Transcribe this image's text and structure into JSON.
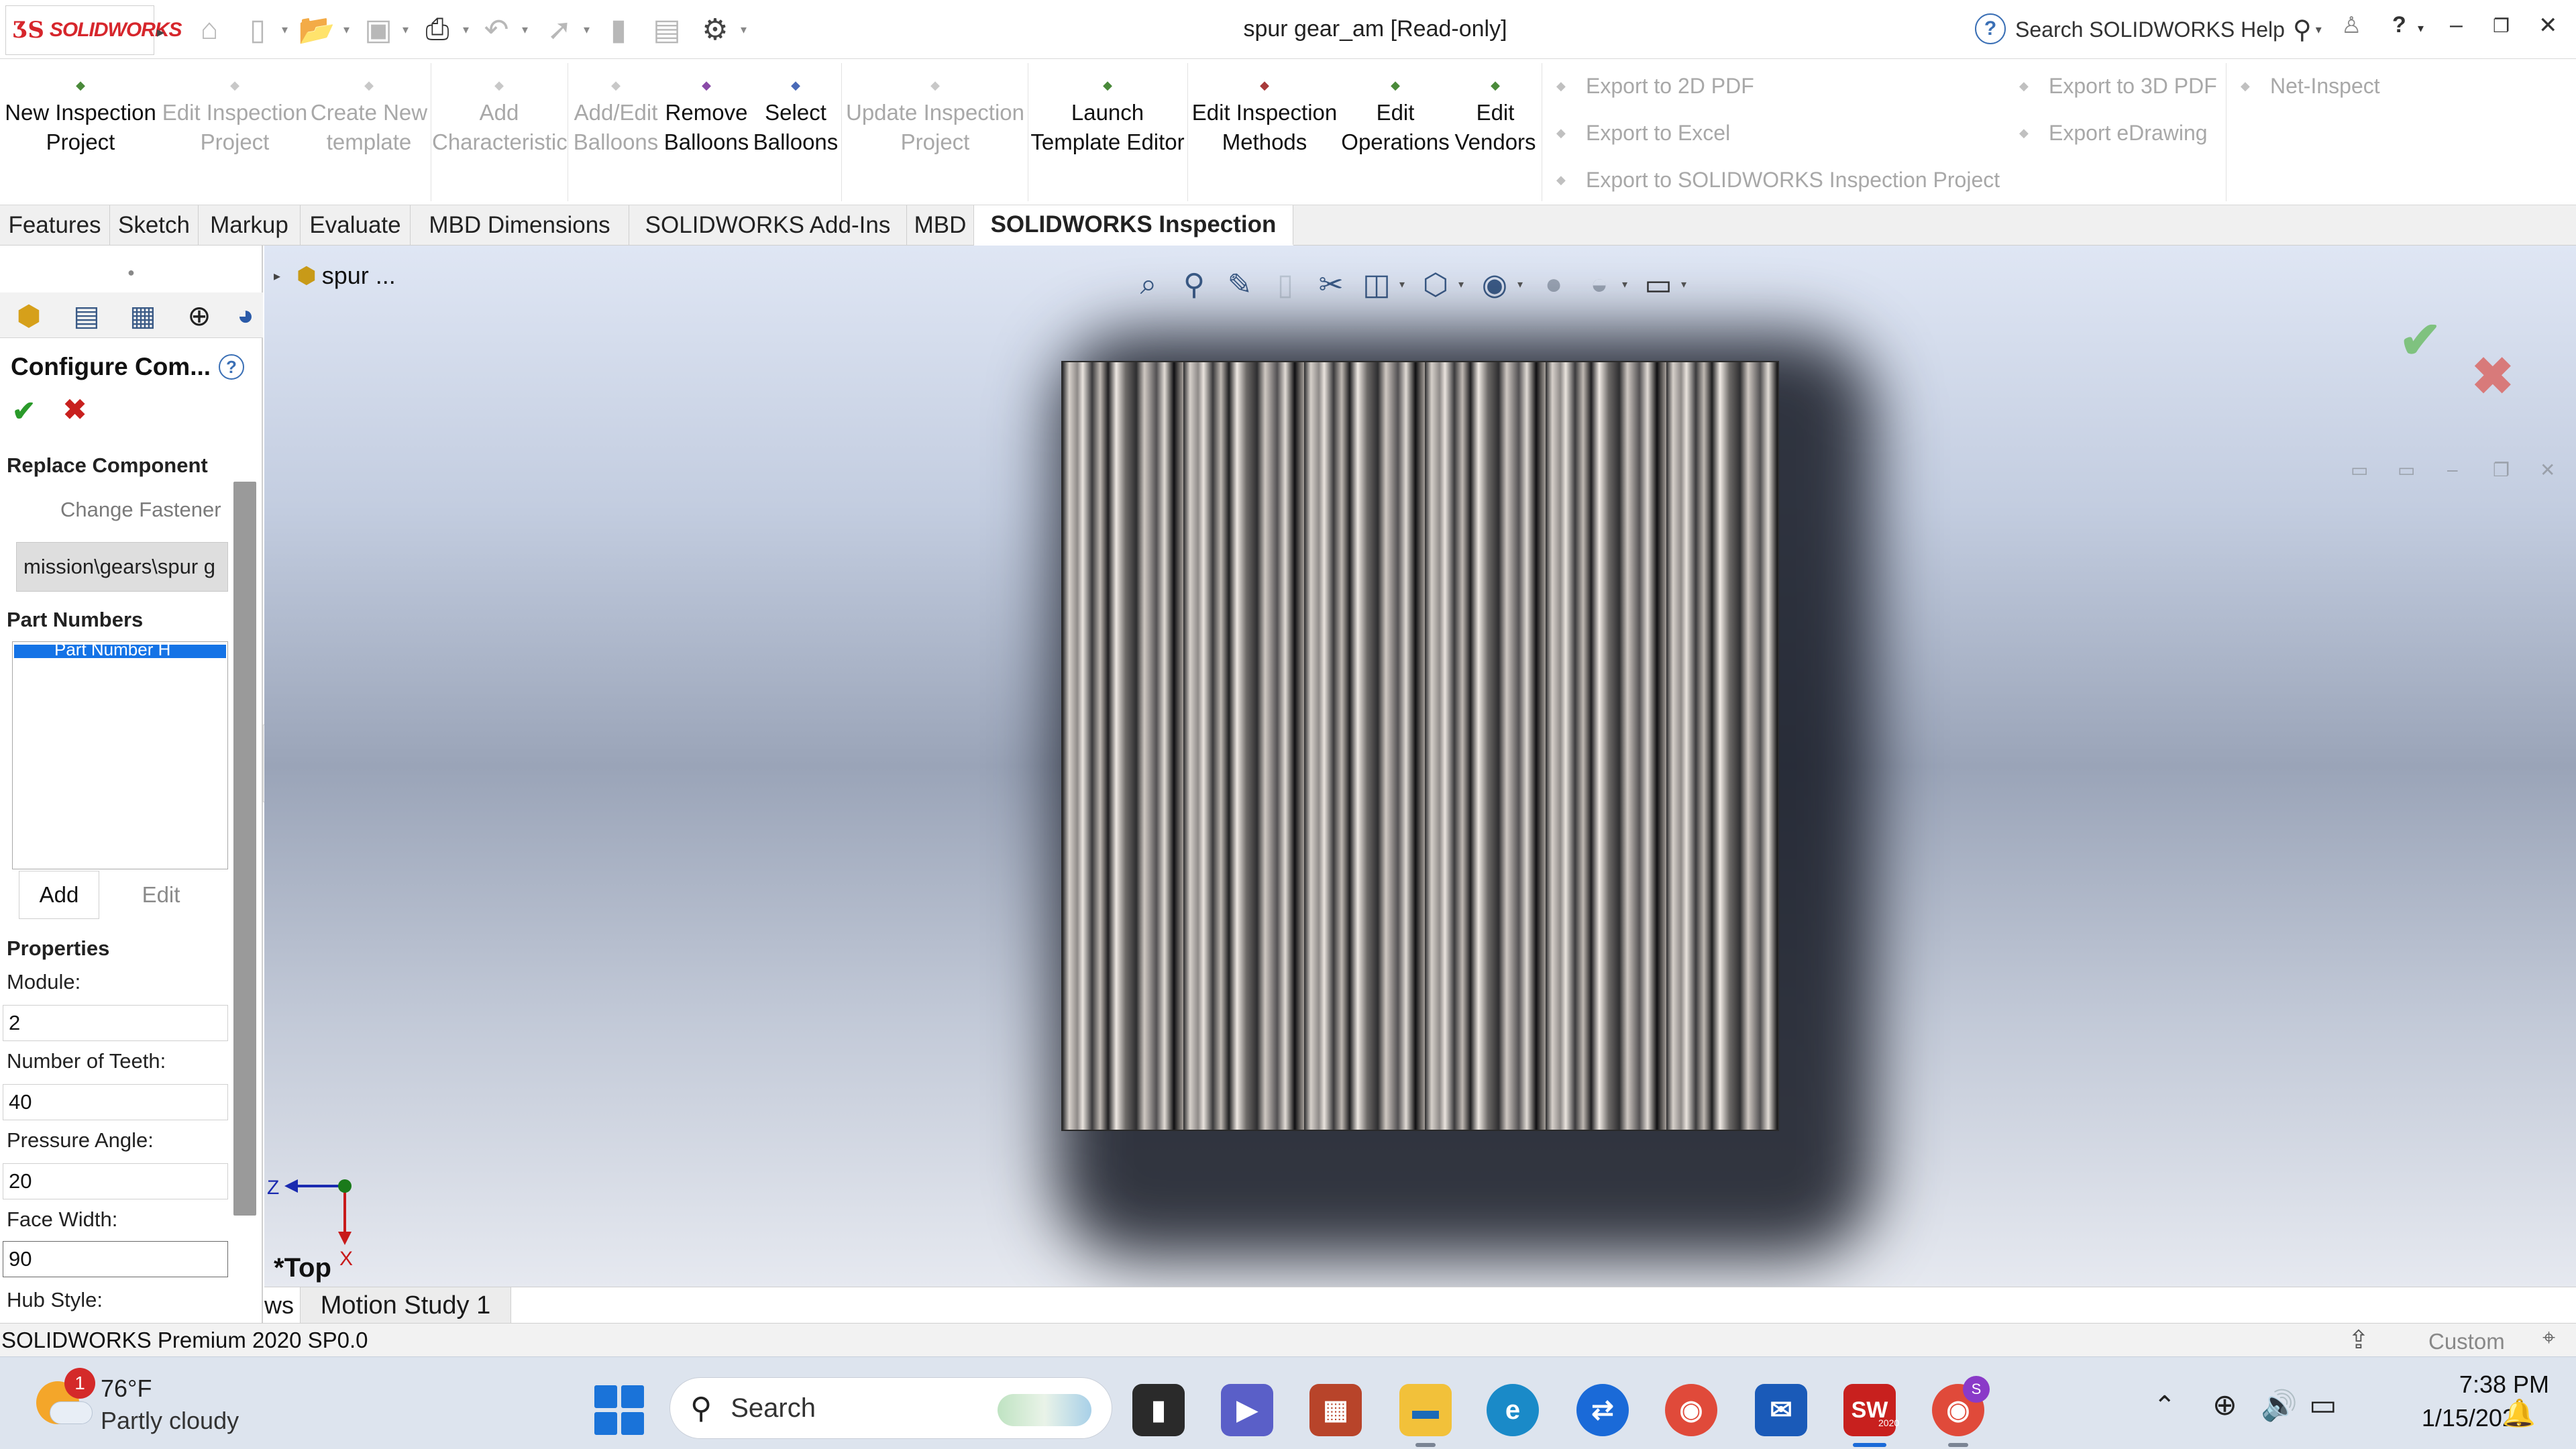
{
  "app": {
    "brand": "SOLIDWORKS",
    "brand_color": "#d6262c",
    "document_title": "spur gear_am [Read-only]",
    "help_search_placeholder": "Search SOLIDWORKS Help"
  },
  "quick_access": {
    "icons": [
      "home-icon",
      "new-document-icon",
      "open-icon",
      "save-icon",
      "print-icon",
      "undo-icon",
      "select-pointer-icon",
      "rebuild-icon",
      "file-properties-icon",
      "options-gear-icon"
    ]
  },
  "ribbon": {
    "new_inspection_project": "New Inspection Project",
    "edit_inspection_project": "Edit Inspection Project",
    "create_new_template": "Create New template",
    "add_characteristic": "Add Characteristic",
    "add_edit_balloons": "Add/Edit Balloons",
    "remove_balloons": "Remove Balloons",
    "select_balloons": "Select Balloons",
    "update_inspection_project": "Update Inspection Project",
    "launch_template_editor": "Launch Template Editor",
    "edit_inspection_methods": "Edit Inspection Methods",
    "edit_operations": "Edit Operations",
    "edit_vendors": "Edit Vendors",
    "export_2d_pdf": "Export to 2D PDF",
    "export_excel": "Export to Excel",
    "export_sw_inspection": "Export to SOLIDWORKS Inspection Project",
    "export_3d_pdf": "Export to 3D PDF",
    "export_edrawing": "Export eDrawing",
    "net_inspect": "Net-Inspect"
  },
  "tabs": [
    "Features",
    "Sketch",
    "Markup",
    "Evaluate",
    "MBD Dimensions",
    "SOLIDWORKS Add-Ins",
    "MBD",
    "SOLIDWORKS Inspection"
  ],
  "active_tab": "SOLIDWORKS Inspection",
  "property_manager": {
    "title": "Configure Com...",
    "replace_component_heading": "Replace Component",
    "change_fastener": "Change Fastener",
    "file_path": "mission\\gears\\spur g",
    "part_numbers_heading": "Part Numbers",
    "selected_part_number": "Part Number H",
    "add_label": "Add",
    "edit_label": "Edit",
    "properties_heading": "Properties",
    "module_label": "Module:",
    "module_value": "2",
    "teeth_label": "Number of Teeth:",
    "teeth_value": "40",
    "pressure_angle_label": "Pressure Angle:",
    "pressure_angle_value": "20",
    "face_width_label": "Face Width:",
    "face_width_value": "90",
    "hub_style_label": "Hub Style:"
  },
  "viewport": {
    "tree_node": "spur ...",
    "view_name": "*Top",
    "triad_z": "Z",
    "triad_x": "X"
  },
  "bottom_tabs": {
    "views_partial": "ws",
    "motion_study": "Motion Study 1"
  },
  "status": {
    "version": "SOLIDWORKS Premium 2020 SP0.0",
    "units": "Custom"
  },
  "taskbar": {
    "weather_temp": "76°F",
    "weather_condition": "Partly cloudy",
    "weather_badge": "1",
    "search_label": "Search",
    "time": "7:38 PM",
    "date": "1/15/2024",
    "sw_badge": "2020",
    "chrome_badge": "S"
  }
}
